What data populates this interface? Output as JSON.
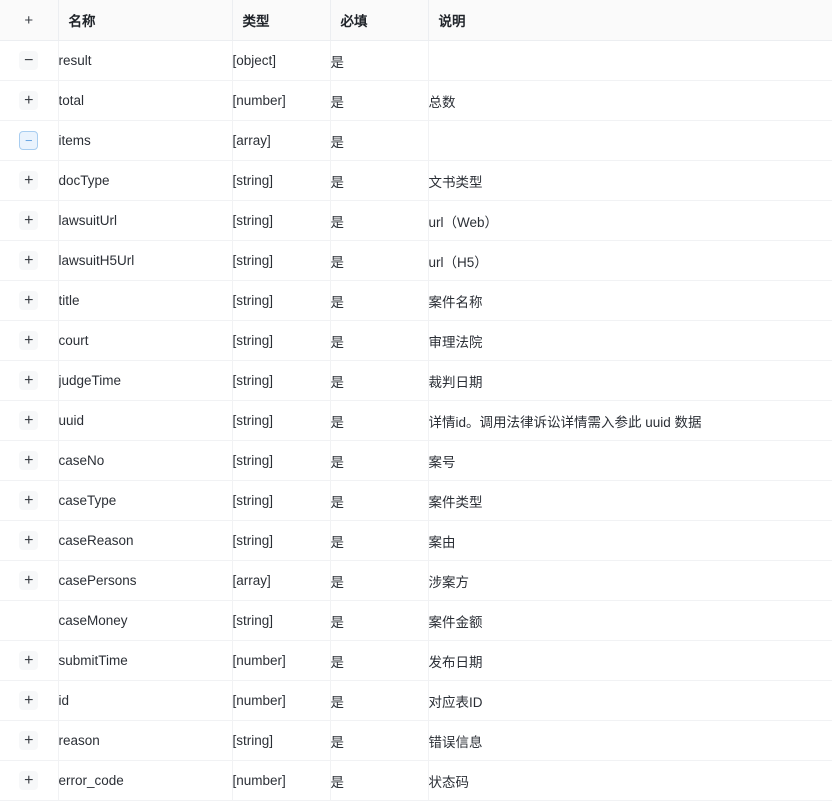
{
  "table": {
    "columns": {
      "toggle": "+",
      "name": "名称",
      "type": "类型",
      "required": "必填",
      "description": "说明"
    },
    "rows": [
      {
        "toggle": "minus",
        "indent": 1,
        "name": "result",
        "type": "[object]",
        "required": "是",
        "description": ""
      },
      {
        "toggle": "plus",
        "indent": 2,
        "name": "total",
        "type": "[number]",
        "required": "是",
        "description": "总数"
      },
      {
        "toggle": "minus-active",
        "indent": 2,
        "name": "items",
        "type": "[array]",
        "required": "是",
        "description": ""
      },
      {
        "toggle": "plus",
        "indent": 3,
        "name": "docType",
        "type": "[string]",
        "required": "是",
        "description": "文书类型"
      },
      {
        "toggle": "plus",
        "indent": 3,
        "name": "lawsuitUrl",
        "type": "[string]",
        "required": "是",
        "description": "url（Web）"
      },
      {
        "toggle": "plus",
        "indent": 3,
        "name": "lawsuitH5Url",
        "type": "[string]",
        "required": "是",
        "description": "url（H5）"
      },
      {
        "toggle": "plus",
        "indent": 3,
        "name": "title",
        "type": "[string]",
        "required": "是",
        "description": "案件名称"
      },
      {
        "toggle": "plus",
        "indent": 3,
        "name": "court",
        "type": "[string]",
        "required": "是",
        "description": "审理法院"
      },
      {
        "toggle": "plus",
        "indent": 3,
        "name": "judgeTime",
        "type": "[string]",
        "required": "是",
        "description": "裁判日期"
      },
      {
        "toggle": "plus",
        "indent": 3,
        "name": "uuid",
        "type": "[string]",
        "required": "是",
        "description": "详情id。调用法律诉讼详情需入参此 uuid 数据"
      },
      {
        "toggle": "plus",
        "indent": 3,
        "name": "caseNo",
        "type": "[string]",
        "required": "是",
        "description": "案号"
      },
      {
        "toggle": "plus",
        "indent": 3,
        "name": "caseType",
        "type": "[string]",
        "required": "是",
        "description": "案件类型"
      },
      {
        "toggle": "plus",
        "indent": 3,
        "name": "caseReason",
        "type": "[string]",
        "required": "是",
        "description": "案由"
      },
      {
        "toggle": "plus",
        "indent": 3,
        "name": "casePersons",
        "type": "[array]",
        "required": "是",
        "description": "涉案方"
      },
      {
        "toggle": "none",
        "indent": 3,
        "name": "caseMoney",
        "type": "[string]",
        "required": "是",
        "description": "案件金额"
      },
      {
        "toggle": "plus",
        "indent": 3,
        "name": "submitTime",
        "type": "[number]",
        "required": "是",
        "description": "发布日期"
      },
      {
        "toggle": "plus",
        "indent": 3,
        "name": "id",
        "type": "[number]",
        "required": "是",
        "description": "对应表ID"
      },
      {
        "toggle": "plus",
        "indent": 1,
        "name": "reason",
        "type": "[string]",
        "required": "是",
        "description": "错误信息"
      },
      {
        "toggle": "plus",
        "indent": 1,
        "name": "error_code",
        "type": "[number]",
        "required": "是",
        "description": "状态码"
      }
    ],
    "icons": {
      "plus": "+",
      "minus": "−",
      "minus-active": "−"
    },
    "colors": {
      "header_bg": "#fafafa",
      "border": "#f1f2f4",
      "accent_blue": "#5f9fe0",
      "accent_blue_bg": "#eaf3fd",
      "accent_blue_border": "#a8cdf0",
      "text": "#2b2f36"
    }
  }
}
